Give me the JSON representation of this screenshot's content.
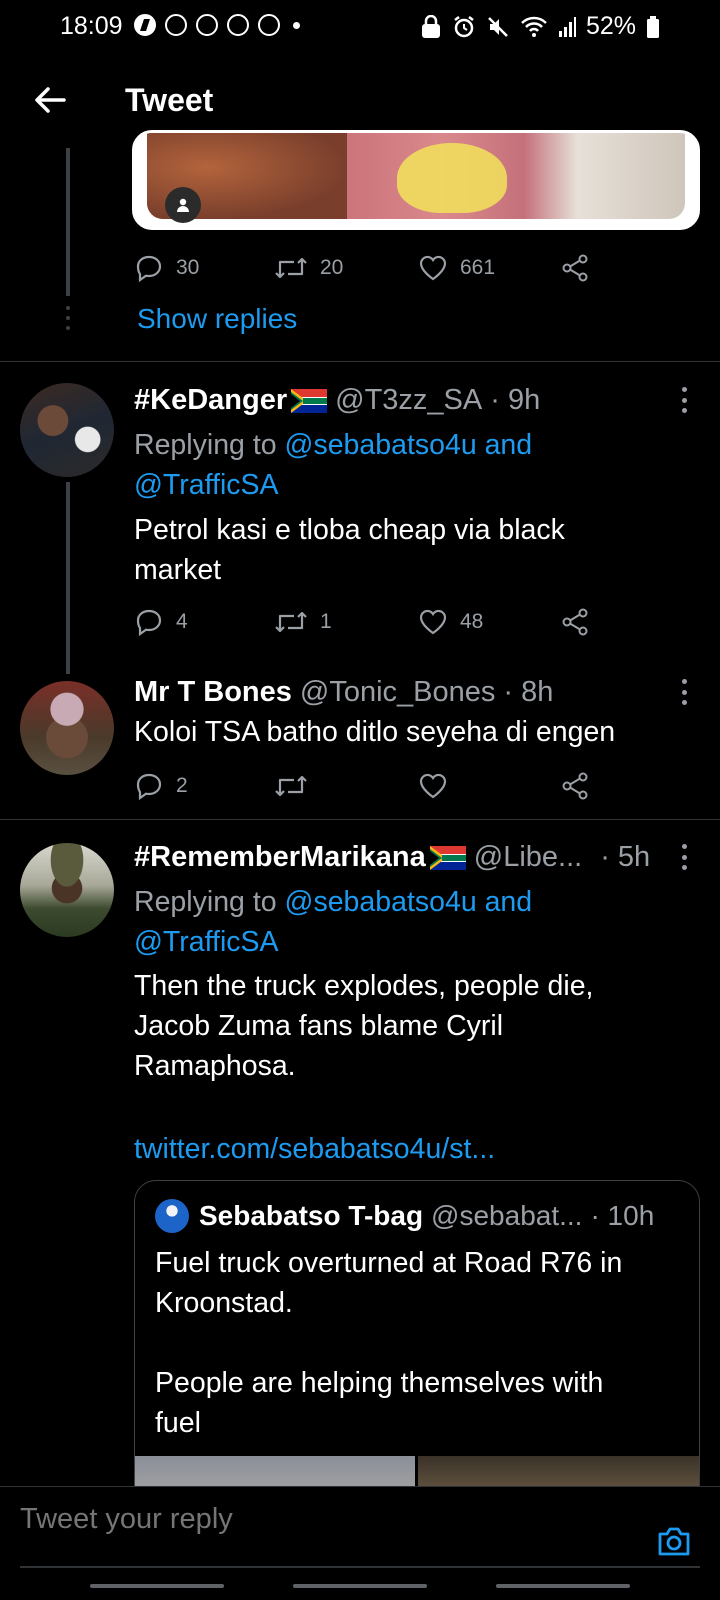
{
  "status_bar": {
    "time": "18:09",
    "battery": "52%"
  },
  "header": {
    "title": "Tweet"
  },
  "previous_tweet": {
    "stats": {
      "replies": "30",
      "retweets": "20",
      "likes": "661"
    },
    "show_replies": "Show replies"
  },
  "tweets": [
    {
      "name": "#KeDanger",
      "handle": "@T3zz_SA",
      "time": "· 9h",
      "replying_prefix": "Replying to",
      "replying_to": "@sebabatso4u and",
      "replying_to_2": "@TrafficSA",
      "text_line1": "Petrol kasi e tloba cheap via black",
      "text_line2": "market",
      "stats": {
        "replies": "4",
        "retweets": "1",
        "likes": "48"
      }
    },
    {
      "name": "Mr T Bones",
      "handle": "@Tonic_Bones",
      "time": "· 8h",
      "text_line1": "Koloi TSA batho ditlo seyeha di engen",
      "stats": {
        "replies": "2",
        "retweets": "",
        "likes": ""
      }
    },
    {
      "name": "#RememberMarikana",
      "handle": "@Libe...",
      "time": "· 5h",
      "replying_prefix": "Replying to",
      "replying_to": "@sebabatso4u and",
      "replying_to_2": "@TrafficSA",
      "text_line1": "Then the truck explodes, people die,",
      "text_line2": "Jacob Zuma fans blame Cyril",
      "text_line3": "Ramaphosa.",
      "link": "twitter.com/sebabatso4u/st...",
      "quote": {
        "name": "Sebabatso T-bag",
        "handle": "@sebabat...",
        "time": "· 10h",
        "text_line1": "Fuel truck overturned at Road R76 in",
        "text_line2": "Kroonstad.",
        "text_line3": "People are helping themselves with",
        "text_line4": "fuel"
      }
    }
  ],
  "reply_bar": {
    "placeholder": "Tweet your reply"
  },
  "colors": {
    "background": "#000000",
    "link": "#1d9bf0",
    "muted": "#9aa0a6"
  }
}
